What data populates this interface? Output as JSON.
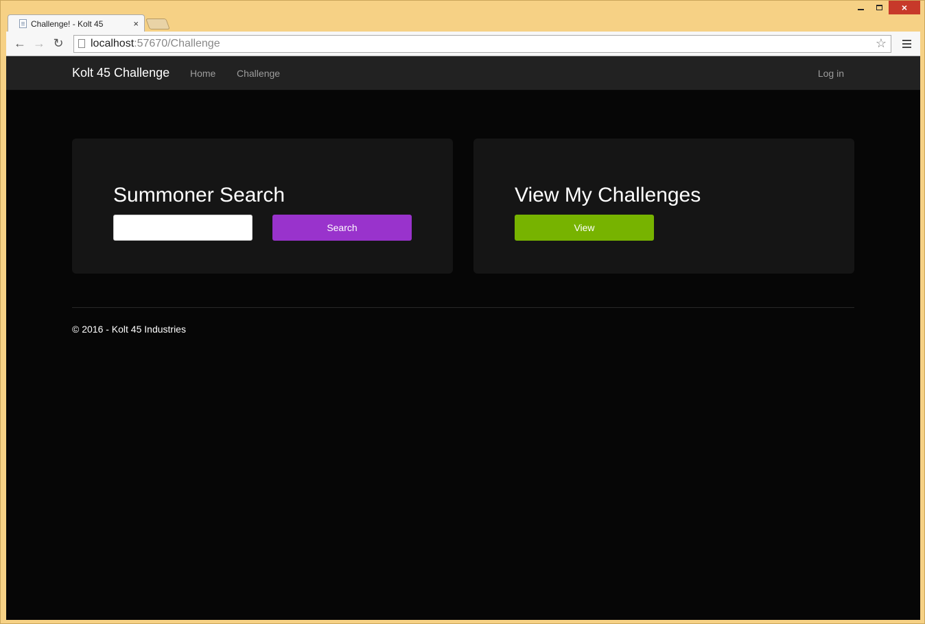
{
  "browser": {
    "tab_title": "Challenge! - Kolt 45",
    "tab_close": "×",
    "url_host": "localhost",
    "url_rest": ":57670/Challenge",
    "back_glyph": "←",
    "forward_glyph": "→",
    "reload_glyph": "↻",
    "star_glyph": "☆",
    "window_close": "×",
    "icons": {
      "back": "arrow-left-icon",
      "forward": "arrow-right-icon",
      "reload": "reload-icon",
      "bookmark": "star-icon",
      "menu": "hamburger-menu-icon"
    }
  },
  "navbar": {
    "brand": "Kolt 45 Challenge",
    "links": [
      "Home",
      "Challenge"
    ],
    "login": "Log in"
  },
  "search_panel": {
    "title": "Summoner Search",
    "input_value": "",
    "button_label": "Search"
  },
  "challenges_panel": {
    "title": "View My Challenges",
    "button_label": "View"
  },
  "footer": {
    "text": "© 2016 - Kolt 45 Industries"
  },
  "colors": {
    "page_bg": "#060606",
    "navbar_bg": "#222222",
    "panel_bg": "#151515",
    "search_button": "#9933cc",
    "view_button": "#77b300",
    "window_frame": "#f6d185"
  }
}
